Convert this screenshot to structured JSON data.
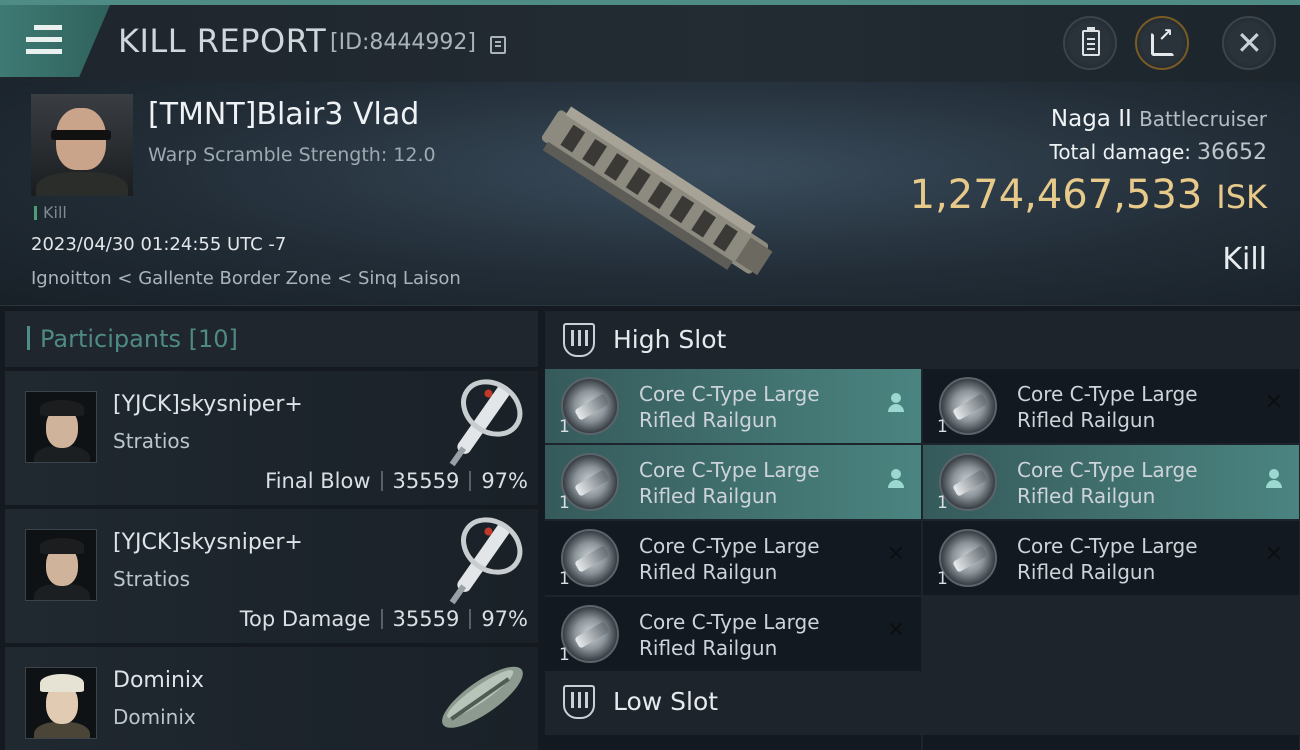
{
  "header": {
    "title": "KILL REPORT",
    "report_id": "[ID:8444992]",
    "buttons": {
      "menu": "menu-icon",
      "clipboard": "clipboard-icon",
      "share": "share-icon",
      "close": "close-icon"
    },
    "close_glyph": "✕"
  },
  "hero": {
    "pilot_name": "[TMNT]Blair3 Vlad",
    "warp_scramble": "Warp Scramble Strength: 12.0",
    "kill_tag": "Kill",
    "datetime": "2023/04/30 01:24:55 UTC -7",
    "location": "Ignoitton < Gallente Border Zone < Sinq Laison",
    "ship_name": "Naga II",
    "ship_class": "Battlecruiser",
    "total_damage_label": "Total damage:",
    "total_damage_value": "36652",
    "isk_value": "1,274,467,533",
    "isk_unit": "ISK",
    "result": "Kill"
  },
  "participants": {
    "title": "Participants [10]",
    "rows": [
      {
        "name": "[YJCK]skysniper+",
        "ship": "Stratios",
        "role": "Final Blow",
        "damage": "35559",
        "percent": "97%"
      },
      {
        "name": "[YJCK]skysniper+",
        "ship": "Stratios",
        "role": "Top Damage",
        "damage": "35559",
        "percent": "97%"
      },
      {
        "name": "Dominix",
        "ship": "Dominix",
        "role": "",
        "damage": "",
        "percent": ""
      }
    ]
  },
  "slots": {
    "high_slot_title": "High Slot",
    "low_slot_title": "Low Slot",
    "high_modules": [
      {
        "line1": "Core C-Type Large",
        "line2": "Rifled Railgun",
        "qty": "1",
        "status": "dropped"
      },
      {
        "line1": "Core C-Type Large",
        "line2": "Rifled Railgun",
        "qty": "1",
        "status": "destroyed"
      },
      {
        "line1": "Core C-Type Large",
        "line2": "Rifled Railgun",
        "qty": "1",
        "status": "dropped"
      },
      {
        "line1": "Core C-Type Large",
        "line2": "Rifled Railgun",
        "qty": "1",
        "status": "dropped"
      },
      {
        "line1": "Core C-Type Large",
        "line2": "Rifled Railgun",
        "qty": "1",
        "status": "destroyed"
      },
      {
        "line1": "Core C-Type Large",
        "line2": "Rifled Railgun",
        "qty": "1",
        "status": "destroyed"
      },
      {
        "line1": "Core C-Type Large",
        "line2": "Rifled Railgun",
        "qty": "1",
        "status": "destroyed"
      }
    ],
    "destroyed_glyph": "✕"
  },
  "colors": {
    "accent": "#4f8c86",
    "isk": "#e7c98a",
    "active_module": "#4a8480"
  }
}
